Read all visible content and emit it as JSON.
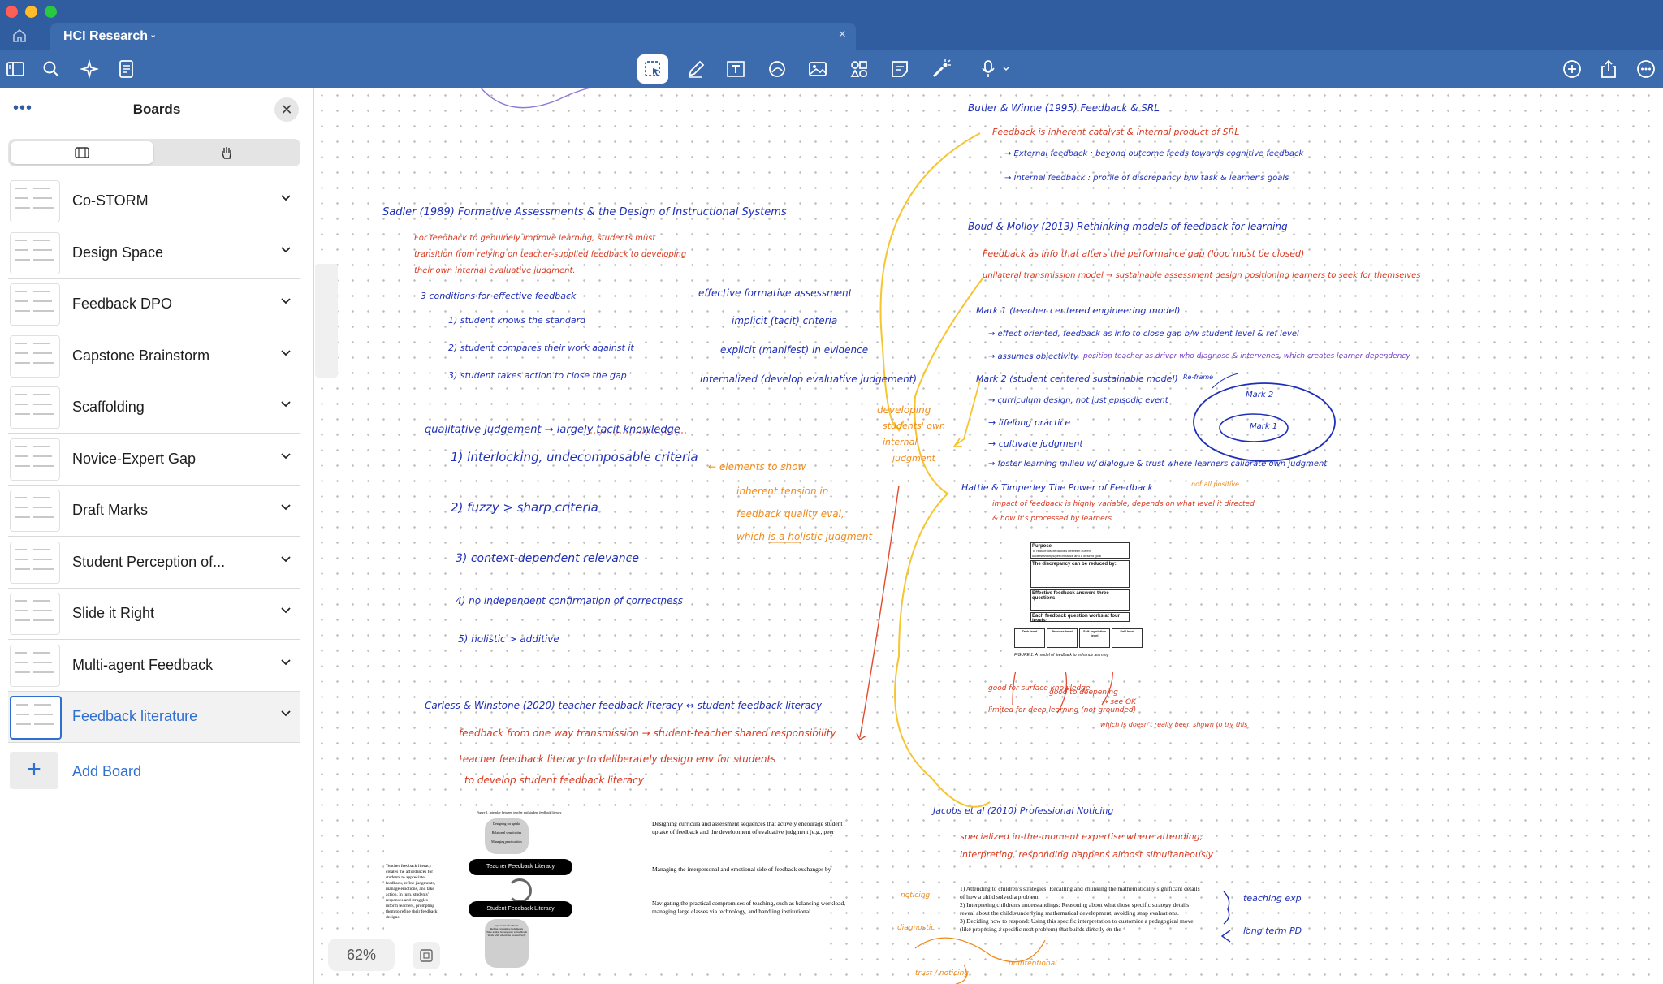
{
  "window": {
    "tab_title": "HCI Research",
    "tab_close": "×"
  },
  "toolbar": {
    "left_tools": [
      "sidebar-icon",
      "search-icon",
      "sparkle-icon",
      "document-icon"
    ],
    "center_tools": [
      "lasso-select-icon",
      "pen-icon",
      "text-box-icon",
      "shapes-icon",
      "image-icon",
      "elements-icon",
      "sticky-note-icon",
      "laser-pointer-icon",
      "microphone-icon"
    ],
    "right_tools": [
      "add-icon",
      "share-icon",
      "more-icon"
    ]
  },
  "sidebar": {
    "title": "Boards",
    "more": "•••",
    "close": "✕",
    "boards": [
      {
        "label": "Co-STORM"
      },
      {
        "label": "Design Space"
      },
      {
        "label": "Feedback DPO"
      },
      {
        "label": "Capstone Brainstorm"
      },
      {
        "label": "Scaffolding"
      },
      {
        "label": "Novice-Expert Gap"
      },
      {
        "label": "Draft Marks"
      },
      {
        "label": "Student Perception of..."
      },
      {
        "label": "Slide it Right"
      },
      {
        "label": "Multi-agent Feedback"
      },
      {
        "label": "Feedback literature"
      }
    ],
    "selected_index": 10,
    "add_board": "Add Board",
    "add_plus": "+"
  },
  "canvas": {
    "zoom": "62%",
    "notes": {
      "sadler": "Sadler (1989)  Formative Assessments & the Design of Instructional Systems",
      "sadler_1": "For feedback to genuinely improve learning, students must",
      "sadler_2": "transition from relying on teacher-supplied feedback to developing",
      "sadler_3": "their own internal evaluative judgment.",
      "cond": "3 conditions for effective feedback",
      "c1": "1) student knows the standard",
      "c2": "2) student compares their work against it",
      "c3": "3) student takes action to close the gap",
      "efa": "effective formative assessment",
      "efa1": "implicit (tacit) criteria",
      "efa2": "explicit (manifest) in evidence",
      "efa3": "internalized (develop evaluative judgement)",
      "qj": "qualitative judgement  →  largely tacit knowledge",
      "q1": "1) interlocking, undecomposable criteria",
      "q2": "2) fuzzy > sharp criteria",
      "q3": "3) context-dependent relevance",
      "q4": "4) no independent confirmation of correctness",
      "q5": "5) holistic > additive",
      "elem": "← elements to show",
      "elem1": "inherent tension in",
      "elem2": "feedback quality eval,",
      "elem3": "which is a holistic judgment",
      "dev1": "developing",
      "dev2": "students' own",
      "dev3": "internal",
      "dev4": "judgment",
      "butler": "Butler & Winne (1995)  Feedback & SRL",
      "butler1": "Feedback is inherent catalyst & internal product of SRL",
      "butler2": "→ External feedback : beyond outcome feeds towards cognitive feedback",
      "butler3": "→ Internal feedback : profile of discrepancy b/w task & learner's goals",
      "boud": "Boud & Molloy (2013)  Rethinking models of feedback for learning",
      "boud1": "Feedback as info that alters the performance gap (loop must be closed)",
      "boud2": "unilateral transmission model → sustainable assessment design positioning learners to seek for themselves",
      "mark1": "Mark 1 (teacher centered engineering model)",
      "mark1a": "→ effect oriented, feedback as info to close gap b/w student level & ref level",
      "mark1b": "→ assumes objectivity",
      "mark1b_p": "position teacher as driver who diagnose & intervenes, which creates learner dependency",
      "mark2": "Mark 2 (student centered sustainable model)",
      "mark2_note": "Re-frame",
      "mark2a": "→ curriculum design, not just episodic event",
      "mark2b": "→ lifelong practice",
      "mark2c": "→ cultivate judgment",
      "mark2d": "→ foster learning milieu w/ dialogue & trust where learners calibrate own judgment",
      "ellipse_outer": "Mark 2",
      "ellipse_inner": "Mark 1",
      "hattie": "Hattie & Timperley  The Power of Feedback",
      "hattie_o": "not all positive",
      "hattie1": "impact of feedback is highly variable, depends on what level it directed",
      "hattie2": "& how it's processed by learners",
      "carless": "Carless & Winstone (2020)  teacher feedback literacy ↔ student feedback literacy",
      "carless1": "feedback from one way transmission → student-teacher shared responsibility",
      "carless2": "teacher feedback literacy to deliberately design env for students",
      "carless3": "to develop student feedback literacy",
      "jacobs": "Jacobs et al (2010)  Professional Noticing",
      "jacobs1": "specialized in-the-moment expertise where attending,",
      "jacobs2": "interpreting, responding happens almost simultaneously",
      "jacobs_a": "1) Attending to children's strategies: Recalling and chunking the mathematically significant details of how a child solved a problem.",
      "jacobs_b": "2) Interpreting children's understandings: Reasoning about what those specific strategy details reveal about the child's underlying mathematical development, avoiding snap evaluations.",
      "jacobs_c": "3) Deciding how to respond: Using this specific interpretation to customize a pedagogical move (like proposing a specific next problem) that builds directly on the",
      "teach_exp": "teaching exp",
      "long_pd": "long term PD",
      "good1": "good for surface knowledge",
      "good2": "good to deepening",
      "see": "→ see OK",
      "limited": "limited for deep learning (not grounded)",
      "which": "which is doesn't really been shown to try this",
      "orange_left1": "noticing",
      "orange_left2": "diagnostic",
      "orange_bottom": "trust / noticing",
      "orange_b2": "unintentional",
      "fig1_rows": [
        "Designing curricula and assessment sequences that actively encourage student uptake of feedback and the development of evaluative judgment (e.g., peer",
        "Managing the interpersonal and emotional side of feedback exchanges by",
        "Navigating the practical compromises of teaching, such as balancing workload, managing large classes via technology, and handling institutional"
      ],
      "fig1_title": "Figure 1. Interplay between teacher and student feedback literacy",
      "fig1_teacher": "Teacher Feedback Literacy",
      "fig1_student": "Student Feedback Literacy",
      "fig1_side": "Teacher feedback literacy creates the affordances for students to appreciate feedback, refine judgments, manage emotions, and take action. In turn, students' responses and struggles inform teachers, prompting them to refine their feedback designs",
      "fig1_pills_top": [
        "Designing for uptake",
        "Relational sensitivities",
        "Managing practicalities"
      ],
      "fig1_pills_bot": [
        "Appreciate feedback",
        "Refine evaluative judgments",
        "Take action in response to feedback",
        "Work with emotions productively"
      ],
      "fig2_purpose": "Purpose",
      "fig2_purpose_t": "To reduce discrepancies between current understandings/performance and a desired goal",
      "fig2_disc": "The discrepancy can be reduced by:",
      "fig2_q": "Effective feedback answers three questions",
      "fig2_levels": "Each feedback question works at four levels:",
      "fig2_cols": [
        "Task level",
        "Process level",
        "Self-regulation level",
        "Self level"
      ],
      "fig2_caption": "FIGURE 1. A model of feedback to enhance learning"
    }
  }
}
